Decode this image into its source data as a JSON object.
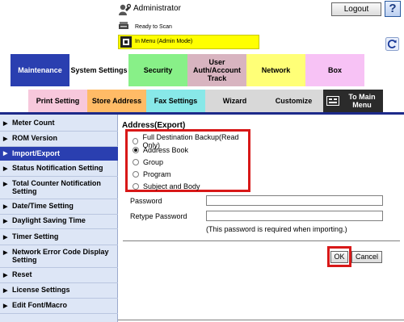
{
  "header": {
    "user_label": "Administrator",
    "logout_label": "Logout",
    "help_label": "?",
    "status_text": "Ready to Scan",
    "mode_text": "In Menu (Admin Mode)"
  },
  "tabs_top": [
    {
      "label": "Maintenance",
      "color": "#2a3fb0",
      "active": true
    },
    {
      "label": "System Settings",
      "color": "#ffffff"
    },
    {
      "label": "Security",
      "color": "#88f088"
    },
    {
      "label": "User Auth/Account Track",
      "color": "#d8b4c0"
    },
    {
      "label": "Network",
      "color": "#ffff77"
    },
    {
      "label": "Box",
      "color": "#f7c2f5"
    }
  ],
  "tabs_bottom": [
    {
      "label": "Print Setting",
      "color": "#f7c8dc"
    },
    {
      "label": "Store Address",
      "color": "#ffbb66"
    },
    {
      "label": "Fax Settings",
      "color": "#88e8e8"
    },
    {
      "label": "Wizard",
      "color": "#d8d8d8"
    },
    {
      "label": "Customize",
      "color": "#d8d8d8"
    },
    {
      "label": "To Main Menu",
      "color": "#2b2b2b"
    }
  ],
  "sidebar": {
    "items": [
      {
        "label": "Meter Count"
      },
      {
        "label": "ROM Version"
      },
      {
        "label": "Import/Export",
        "active": true
      },
      {
        "label": "Status Notification Setting"
      },
      {
        "label": "Total Counter Notification Setting"
      },
      {
        "label": "Date/Time Setting"
      },
      {
        "label": "Daylight Saving Time"
      },
      {
        "label": "Timer Setting"
      },
      {
        "label": "Network Error Code Display Setting"
      },
      {
        "label": "Reset"
      },
      {
        "label": "License Settings"
      },
      {
        "label": "Edit Font/Macro"
      }
    ]
  },
  "main": {
    "title": "Address(Export)",
    "options": [
      {
        "label": "Full Destination Backup(Read Only)",
        "selected": false
      },
      {
        "label": "Address Book",
        "selected": true
      },
      {
        "label": "Group",
        "selected": false
      },
      {
        "label": "Program",
        "selected": false
      },
      {
        "label": "Subject and Body",
        "selected": false
      }
    ],
    "password_label": "Password",
    "retype_label": "Retype Password",
    "password_value": "",
    "retype_value": "",
    "hint": "(This password is required when importing.)",
    "ok_label": "OK",
    "cancel_label": "Cancel"
  },
  "colors": {
    "highlight": "#d81818",
    "sidebar_bg": "#dde6f6",
    "nav_blue": "#2a3fb0",
    "mode_bar": "#ffff00"
  }
}
